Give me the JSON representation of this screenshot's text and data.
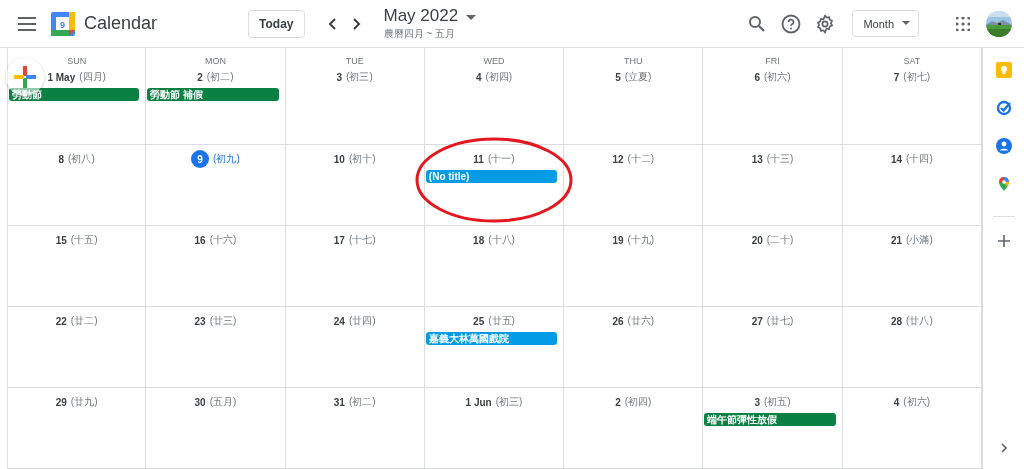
{
  "header": {
    "app_name": "Calendar",
    "logo_day": "9",
    "today_button": "Today",
    "title": "May 2022",
    "subtitle": "農曆四月 ~ 五月",
    "view_button": "Month"
  },
  "weekdays": [
    "SUN",
    "MON",
    "TUE",
    "WED",
    "THU",
    "FRI",
    "SAT"
  ],
  "weeks": [
    [
      {
        "date": "1 May",
        "lunar": "(四月)",
        "today": false,
        "circled": false,
        "events": [
          {
            "title": "勞動節",
            "color": "#0b8043"
          }
        ]
      },
      {
        "date": "2",
        "lunar": "(初二)",
        "today": false,
        "circled": false,
        "events": [
          {
            "title": "勞動節 補假",
            "color": "#0b8043"
          }
        ]
      },
      {
        "date": "3",
        "lunar": "(初三)",
        "today": false,
        "circled": false
      },
      {
        "date": "4",
        "lunar": "(初四)",
        "today": false,
        "circled": false
      },
      {
        "date": "5",
        "lunar": "(立夏)",
        "today": false,
        "circled": false
      },
      {
        "date": "6",
        "lunar": "(初六)",
        "today": false,
        "circled": false
      },
      {
        "date": "7",
        "lunar": "(初七)",
        "today": false,
        "circled": false
      }
    ],
    [
      {
        "date": "8",
        "lunar": "(初八)",
        "today": false,
        "circled": false
      },
      {
        "date": "9",
        "lunar": "(初九)",
        "today": true,
        "circled": false
      },
      {
        "date": "10",
        "lunar": "(初十)",
        "today": false,
        "circled": false
      },
      {
        "date": "11",
        "lunar": "(十一)",
        "today": false,
        "circled": true,
        "events": [
          {
            "title": "(No title)",
            "color": "#039be5"
          }
        ]
      },
      {
        "date": "12",
        "lunar": "(十二)",
        "today": false,
        "circled": false
      },
      {
        "date": "13",
        "lunar": "(十三)",
        "today": false,
        "circled": false
      },
      {
        "date": "14",
        "lunar": "(十四)",
        "today": false,
        "circled": false
      }
    ],
    [
      {
        "date": "15",
        "lunar": "(十五)",
        "today": false,
        "circled": false
      },
      {
        "date": "16",
        "lunar": "(十六)",
        "today": false,
        "circled": false
      },
      {
        "date": "17",
        "lunar": "(十七)",
        "today": false,
        "circled": false
      },
      {
        "date": "18",
        "lunar": "(十八)",
        "today": false,
        "circled": false
      },
      {
        "date": "19",
        "lunar": "(十九)",
        "today": false,
        "circled": false
      },
      {
        "date": "20",
        "lunar": "(二十)",
        "today": false,
        "circled": false
      },
      {
        "date": "21",
        "lunar": "(小滿)",
        "today": false,
        "circled": false
      }
    ],
    [
      {
        "date": "22",
        "lunar": "(廿二)",
        "today": false,
        "circled": false
      },
      {
        "date": "23",
        "lunar": "(廿三)",
        "today": false,
        "circled": false
      },
      {
        "date": "24",
        "lunar": "(廿四)",
        "today": false,
        "circled": false
      },
      {
        "date": "25",
        "lunar": "(廿五)",
        "today": false,
        "circled": false,
        "events": [
          {
            "title": "嘉義大林萬國戲院",
            "color": "#039be5"
          }
        ]
      },
      {
        "date": "26",
        "lunar": "(廿六)",
        "today": false,
        "circled": false
      },
      {
        "date": "27",
        "lunar": "(廿七)",
        "today": false,
        "circled": false
      },
      {
        "date": "28",
        "lunar": "(廿八)",
        "today": false,
        "circled": false
      }
    ],
    [
      {
        "date": "29",
        "lunar": "(廿九)",
        "today": false,
        "circled": false
      },
      {
        "date": "30",
        "lunar": "(五月)",
        "today": false,
        "circled": false
      },
      {
        "date": "31",
        "lunar": "(初二)",
        "today": false,
        "circled": false
      },
      {
        "date": "1 Jun",
        "lunar": "(初三)",
        "today": false,
        "circled": false
      },
      {
        "date": "2",
        "lunar": "(初四)",
        "today": false,
        "circled": false
      },
      {
        "date": "3",
        "lunar": "(初五)",
        "today": false,
        "circled": false,
        "events": [
          {
            "title": "端午節彈性放假",
            "color": "#0b8043"
          }
        ]
      },
      {
        "date": "4",
        "lunar": "(初六)",
        "today": false,
        "circled": false
      }
    ]
  ]
}
